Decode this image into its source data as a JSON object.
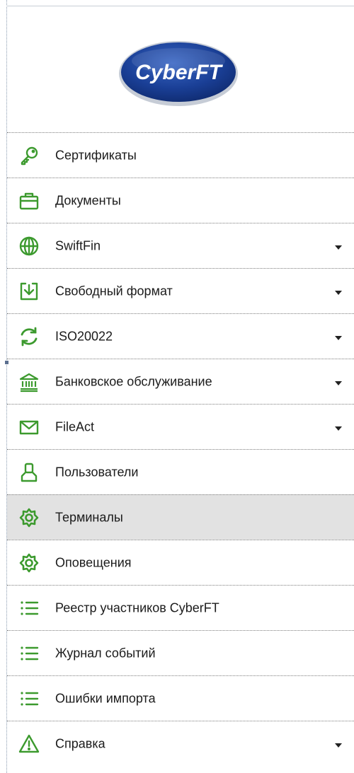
{
  "logo": {
    "text": "CyberFT"
  },
  "menu": [
    {
      "label": "Сертификаты",
      "icon": "key-icon",
      "expandable": false,
      "active": false
    },
    {
      "label": "Документы",
      "icon": "briefcase-icon",
      "expandable": false,
      "active": false
    },
    {
      "label": "SwiftFin",
      "icon": "globe-icon",
      "expandable": true,
      "active": false
    },
    {
      "label": "Свободный формат",
      "icon": "download-box-icon",
      "expandable": true,
      "active": false
    },
    {
      "label": "ISO20022",
      "icon": "refresh-icon",
      "expandable": true,
      "active": false
    },
    {
      "label": "Банковское обслуживание",
      "icon": "bank-icon",
      "expandable": true,
      "active": false
    },
    {
      "label": "FileAct",
      "icon": "envelope-icon",
      "expandable": true,
      "active": false
    },
    {
      "label": "Пользователи",
      "icon": "user-icon",
      "expandable": false,
      "active": false
    },
    {
      "label": "Терминалы",
      "icon": "gear-icon",
      "expandable": false,
      "active": true
    },
    {
      "label": "Оповещения",
      "icon": "gear-icon",
      "expandable": false,
      "active": false
    },
    {
      "label": "Реестр участников CyberFT",
      "icon": "list-icon",
      "expandable": false,
      "active": false
    },
    {
      "label": "Журнал событий",
      "icon": "list-icon",
      "expandable": false,
      "active": false
    },
    {
      "label": "Ошибки импорта",
      "icon": "list-icon",
      "expandable": false,
      "active": false
    },
    {
      "label": "Справка",
      "icon": "warning-icon",
      "expandable": true,
      "active": false
    }
  ],
  "colors": {
    "icon_green": "#3c9a2e",
    "logo_blue": "#1a3f96",
    "active_bg": "#e2e2e2"
  }
}
